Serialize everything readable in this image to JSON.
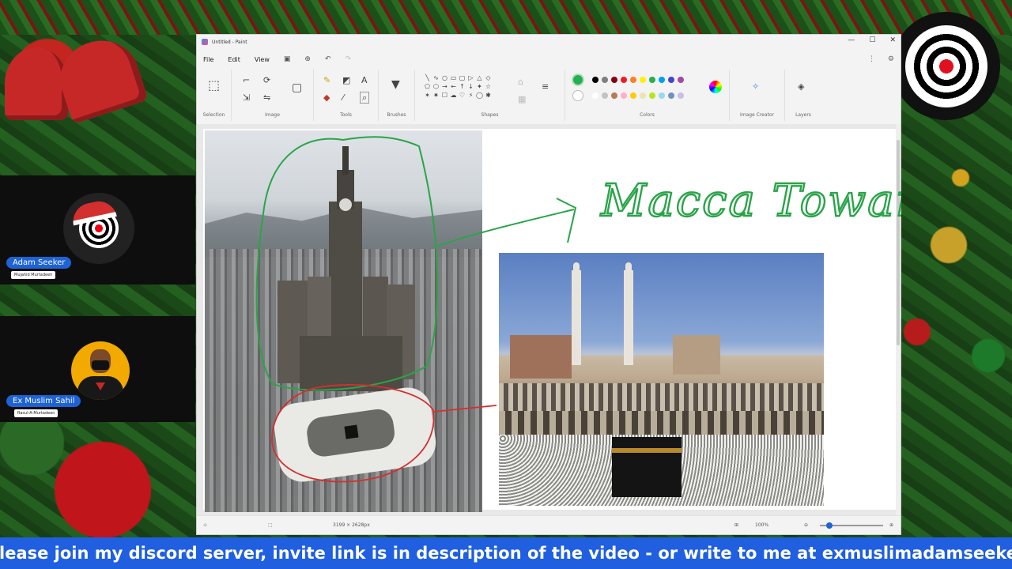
{
  "window": {
    "title": "Untitled - Paint",
    "controls": [
      "—",
      "☐",
      "✕"
    ]
  },
  "menu": {
    "file": "File",
    "edit": "Edit",
    "view": "View"
  },
  "ribbon": {
    "groups": {
      "selection": "Selection",
      "image": "Image",
      "tools": "Tools",
      "brushes": "Brushes",
      "shapes": "Shapes",
      "colors": "Colors",
      "image_creator": "Image Creator",
      "layers": "Layers"
    },
    "palette_row1": [
      "#000000",
      "#7f7f7f",
      "#880015",
      "#ed1c24",
      "#ff7f27",
      "#fff200",
      "#22b14c",
      "#00a2e8",
      "#3f48cc",
      "#a349a4"
    ],
    "palette_row2": [
      "#ffffff",
      "#c3c3c3",
      "#b97a57",
      "#ffaec9",
      "#ffc90e",
      "#efe4b0",
      "#b5e61d",
      "#99d9ea",
      "#7092be",
      "#c8bfe7"
    ],
    "primary_color": "#22b14c"
  },
  "canvas": {
    "annotation_text": "Macca Towar",
    "annotation_color": "#2aa449",
    "circle2_color": "#d32f2f"
  },
  "statusbar": {
    "dimensions": "3199 × 2628px",
    "zoom": "100%"
  },
  "stream": {
    "participant1_name": "Adam Seeker",
    "participant1_sub": "Mujahid Murtadeen",
    "participant2_name": "Ex Muslim Sahil",
    "participant2_sub": "Rasul-A-Murtadeen",
    "ticker": "lease join my discord server, invite link is in description of the video - or write to me at exmuslimadamseeker",
    "ticker_color": "#1f5fe0"
  }
}
